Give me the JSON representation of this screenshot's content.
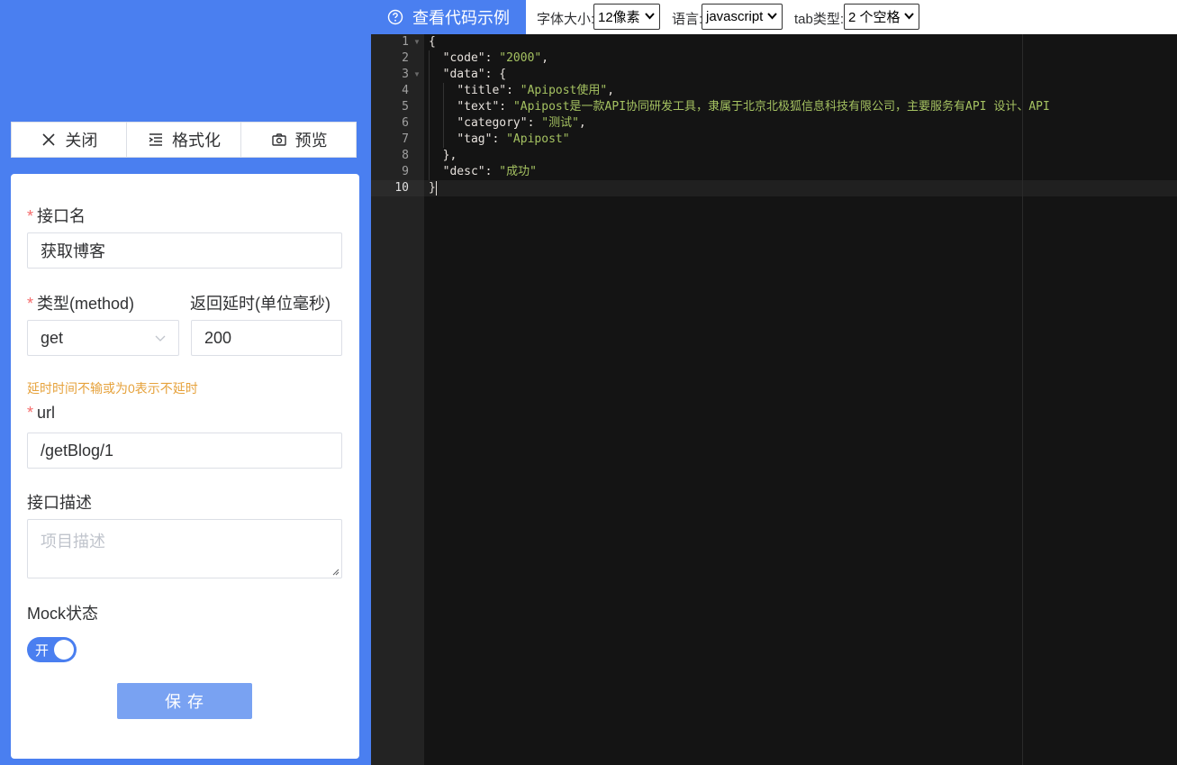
{
  "toolbar": {
    "close_label": "关闭",
    "format_label": "格式化",
    "preview_label": "预览"
  },
  "form": {
    "name_label": "接口名",
    "name_value": "获取博客",
    "method_label": "类型(method)",
    "method_value": "get",
    "delay_label": "返回延时(单位毫秒)",
    "delay_value": "200",
    "delay_hint": "延时时间不输或为0表示不延时",
    "url_label": "url",
    "url_value": "/getBlog/1",
    "desc_label": "接口描述",
    "desc_placeholder": "项目描述",
    "mock_label": "Mock状态",
    "mock_switch_text": "开",
    "save_label": "保  存"
  },
  "topbar": {
    "example_tab": "查看代码示例",
    "font_size_label": "字体大小:",
    "font_size_value": "12像素",
    "language_label": "语言:",
    "language_value": "javascript",
    "tab_type_label": "tab类型:",
    "tab_type_value": "2 个空格"
  },
  "editor": {
    "line_numbers": [
      "1",
      "2",
      "3",
      "4",
      "5",
      "6",
      "7",
      "8",
      "9",
      "10"
    ],
    "line1": "{",
    "line2_key": "\"code\"",
    "line2_val": "\"2000\"",
    "line3_key": "\"data\"",
    "line4_key": "\"title\"",
    "line4_val": "\"Apipost使用\"",
    "line5_key": "\"text\"",
    "line5_val": "\"Apipost是一款API协同研发工具，隶属于北京北极狐信息科技有限公司，主要服务有API 设计、API",
    "line6_key": "\"category\"",
    "line6_val": "\"测试\"",
    "line7_key": "\"tag\"",
    "line7_val": "\"Apipost\"",
    "line8": "},",
    "line9_key": "\"desc\"",
    "line9_val": "\"成功\"",
    "line10": "}"
  },
  "colors": {
    "accent": "#4a7ff0",
    "required": "#f56c6c",
    "hint": "#e6a23c",
    "editor_bg": "#141414",
    "string": "#a5c261"
  }
}
